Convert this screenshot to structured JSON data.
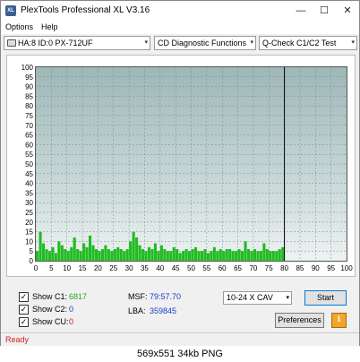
{
  "window": {
    "title": "PlexTools Professional XL V3.16",
    "icon_text": "XL",
    "min": "—",
    "max": "☐",
    "close": "✕"
  },
  "menu": {
    "options": "Options",
    "help": "Help"
  },
  "toolbar": {
    "drive": "HA:8 ID:0  PX-712UF",
    "function": "CD Diagnostic Functions",
    "test": "Q-Check C1/C2 Test",
    "arrow": "▾"
  },
  "chart_data": {
    "type": "bar",
    "xlim": [
      0,
      100
    ],
    "ylim": [
      0,
      100
    ],
    "x_ticks": [
      0,
      5,
      10,
      15,
      20,
      25,
      30,
      35,
      40,
      45,
      50,
      55,
      60,
      65,
      70,
      75,
      80,
      85,
      90,
      95,
      100
    ],
    "y_ticks": [
      0,
      5,
      10,
      15,
      20,
      25,
      30,
      35,
      40,
      45,
      50,
      55,
      60,
      65,
      70,
      75,
      80,
      85,
      90,
      95,
      100
    ],
    "grid": true,
    "disc_end": 80,
    "series": [
      {
        "color": "#22bb22",
        "x": [
          0,
          1,
          2,
          3,
          4,
          5,
          6,
          7,
          8,
          9,
          10,
          11,
          12,
          13,
          14,
          15,
          16,
          17,
          18,
          19,
          20,
          21,
          22,
          23,
          24,
          25,
          26,
          27,
          28,
          29,
          30,
          31,
          32,
          33,
          34,
          35,
          36,
          37,
          38,
          39,
          40,
          41,
          42,
          43,
          44,
          45,
          46,
          47,
          48,
          49,
          50,
          51,
          52,
          53,
          54,
          55,
          56,
          57,
          58,
          59,
          60,
          61,
          62,
          63,
          64,
          65,
          66,
          67,
          68,
          69,
          70,
          71,
          72,
          73,
          74,
          75,
          76,
          77,
          78,
          79
        ],
        "values": [
          5,
          15,
          9,
          6,
          5,
          7,
          4,
          10,
          8,
          6,
          5,
          7,
          12,
          6,
          5,
          9,
          7,
          13,
          8,
          6,
          5,
          6,
          8,
          6,
          5,
          6,
          7,
          6,
          5,
          6,
          10,
          15,
          12,
          8,
          6,
          5,
          7,
          6,
          9,
          5,
          8,
          6,
          5,
          5,
          7,
          6,
          4,
          5,
          6,
          5,
          6,
          7,
          5,
          5,
          6,
          4,
          5,
          7,
          5,
          6,
          5,
          6,
          6,
          5,
          5,
          6,
          5,
          10,
          6,
          5,
          6,
          5,
          5,
          9,
          6,
          5,
          5,
          5,
          6,
          7
        ]
      }
    ]
  },
  "controls": {
    "show_c1_label": "Show C1:",
    "show_c1_value": "6817",
    "show_c2_label": "Show C2:",
    "show_c2_value": "0",
    "show_cu_label": "Show CU:",
    "show_cu_value": "0",
    "check": "✓",
    "msf_label": "MSF:",
    "msf_value": "79:57.70",
    "lba_label": "LBA:",
    "lba_value": "359845",
    "speed": "10-24 X CAV",
    "start": "Start",
    "preferences": "Preferences",
    "info": "i"
  },
  "status": {
    "text": "Ready"
  },
  "caption": "569x551  34kb  PNG"
}
